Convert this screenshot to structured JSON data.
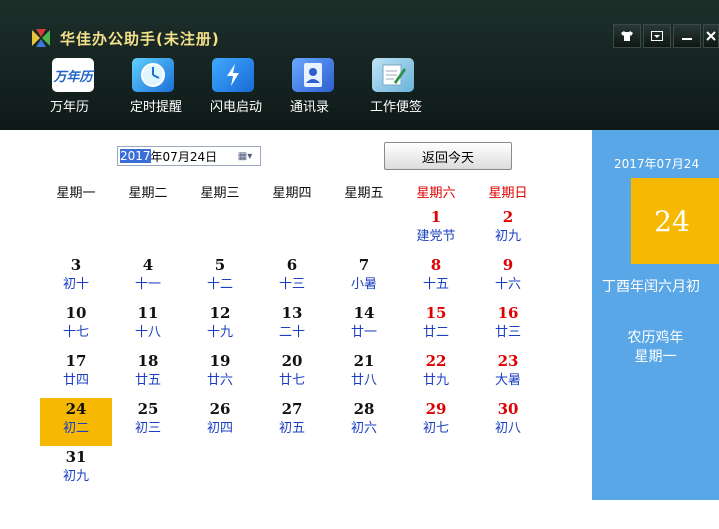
{
  "window": {
    "title": "华佳办公助手(未注册)",
    "controls": [
      "shirt-icon",
      "dropdown-icon",
      "minimize-icon",
      "close-icon"
    ]
  },
  "toolbar": {
    "items": [
      {
        "label": "万年历",
        "icon": "calendar-icon",
        "icon_text": "万年历"
      },
      {
        "label": "定时提醒",
        "icon": "clock-icon"
      },
      {
        "label": "闪电启动",
        "icon": "lightning-icon"
      },
      {
        "label": "通讯录",
        "icon": "contacts-icon"
      },
      {
        "label": "工作便签",
        "icon": "notepad-icon"
      }
    ]
  },
  "datepicker": {
    "year_selected": "2017",
    "rest": "年07月24日"
  },
  "back_today_label": "返回今天",
  "calendar": {
    "weekdays": [
      "星期一",
      "星期二",
      "星期三",
      "星期四",
      "星期五",
      "星期六",
      "星期日"
    ],
    "rows": [
      [
        null,
        null,
        null,
        null,
        null,
        {
          "d": "1",
          "l": "建党节"
        },
        {
          "d": "2",
          "l": "初九"
        }
      ],
      [
        {
          "d": "3",
          "l": "初十"
        },
        {
          "d": "4",
          "l": "十一"
        },
        {
          "d": "5",
          "l": "十二"
        },
        {
          "d": "6",
          "l": "十三"
        },
        {
          "d": "7",
          "l": "小暑"
        },
        {
          "d": "8",
          "l": "十五"
        },
        {
          "d": "9",
          "l": "十六"
        }
      ],
      [
        {
          "d": "10",
          "l": "十七"
        },
        {
          "d": "11",
          "l": "十八"
        },
        {
          "d": "12",
          "l": "十九"
        },
        {
          "d": "13",
          "l": "二十"
        },
        {
          "d": "14",
          "l": "廿一"
        },
        {
          "d": "15",
          "l": "廿二"
        },
        {
          "d": "16",
          "l": "廿三"
        }
      ],
      [
        {
          "d": "17",
          "l": "廿四"
        },
        {
          "d": "18",
          "l": "廿五"
        },
        {
          "d": "19",
          "l": "廿六"
        },
        {
          "d": "20",
          "l": "廿七"
        },
        {
          "d": "21",
          "l": "廿八"
        },
        {
          "d": "22",
          "l": "廿九"
        },
        {
          "d": "23",
          "l": "大暑"
        }
      ],
      [
        {
          "d": "24",
          "l": "初二",
          "today": true
        },
        {
          "d": "25",
          "l": "初三"
        },
        {
          "d": "26",
          "l": "初四"
        },
        {
          "d": "27",
          "l": "初五"
        },
        {
          "d": "28",
          "l": "初六"
        },
        {
          "d": "29",
          "l": "初七"
        },
        {
          "d": "30",
          "l": "初八"
        }
      ],
      [
        {
          "d": "31",
          "l": "初九"
        },
        null,
        null,
        null,
        null,
        null,
        null
      ]
    ]
  },
  "info_panel": {
    "date": "2017年07月24",
    "day": "24",
    "ganzhi": "丁酉年闰六月初",
    "lunar_year": "农历鸡年",
    "weekday": "星期一"
  },
  "colors": {
    "header_bg": "#142220",
    "title": "#f3e08a",
    "weekend": "#e00000",
    "lunar": "#1a3fc0",
    "today_bg": "#f6b800",
    "panel_bg": "#5aa7e8"
  }
}
